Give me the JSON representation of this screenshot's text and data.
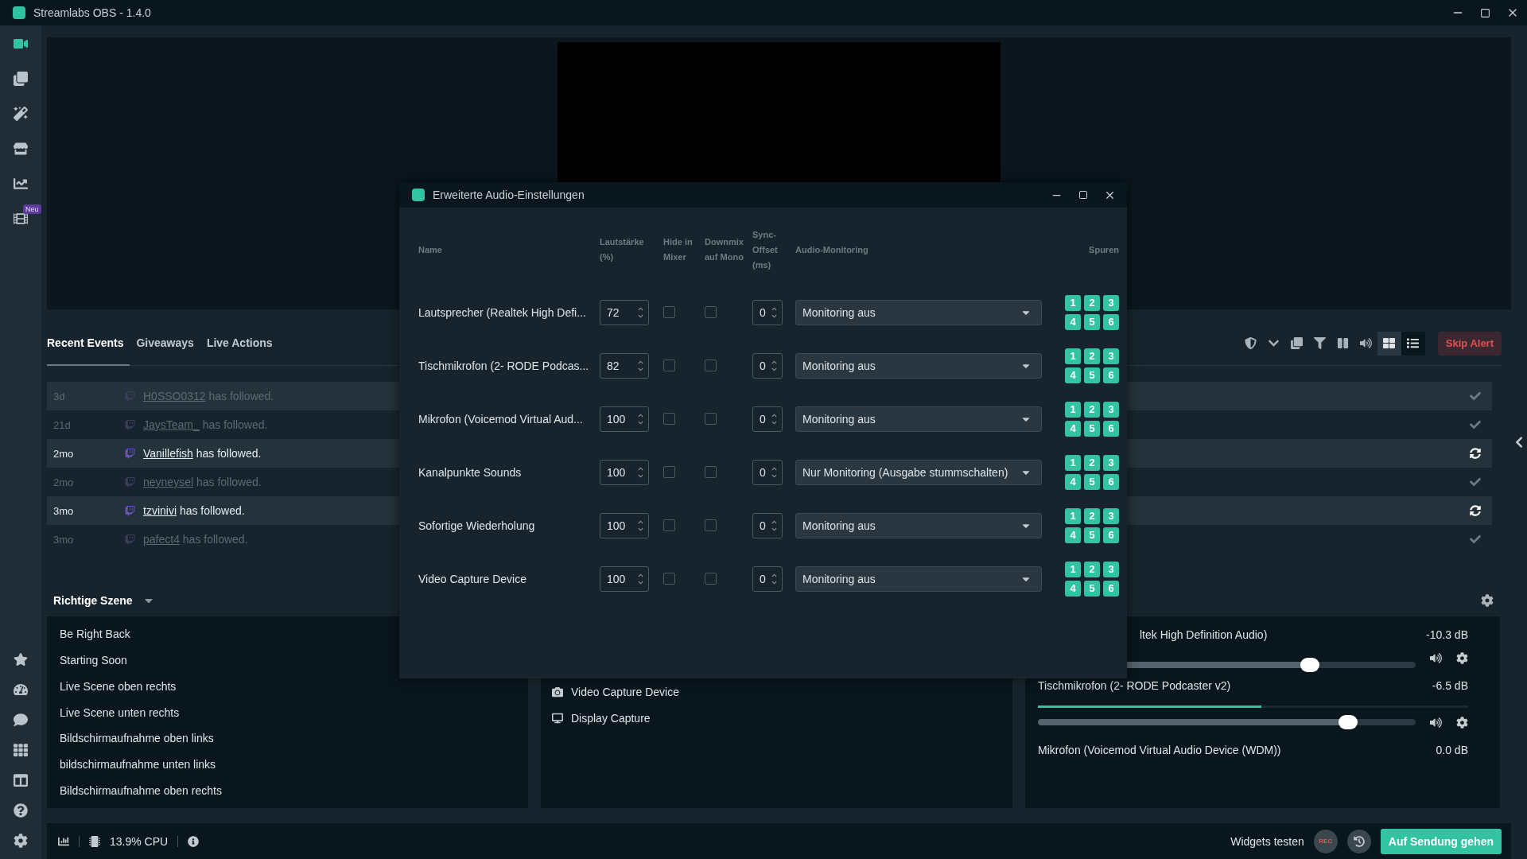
{
  "window": {
    "title": "Streamlabs OBS - 1.4.0"
  },
  "nav": {
    "top": [
      {
        "kind": "studio",
        "selected": true
      },
      {
        "kind": "themes",
        "selected": false
      },
      {
        "kind": "editor",
        "selected": false
      },
      {
        "kind": "store",
        "selected": false
      },
      {
        "kind": "stats",
        "selected": false
      },
      {
        "kind": "highlighter",
        "selected": false,
        "badge": "Neu"
      }
    ],
    "bottom": [
      {
        "kind": "prime"
      },
      {
        "kind": "dashboard"
      },
      {
        "kind": "chat"
      },
      {
        "kind": "layout"
      },
      {
        "kind": "columns"
      },
      {
        "kind": "help"
      },
      {
        "kind": "settings"
      }
    ]
  },
  "events": {
    "tabs": [
      {
        "label": "Recent Events",
        "selected": true
      },
      {
        "label": "Giveaways",
        "selected": false
      },
      {
        "label": "Live Actions",
        "selected": false
      }
    ],
    "views": [
      {
        "kind": "grid",
        "selected": false
      },
      {
        "kind": "list",
        "selected": true
      }
    ],
    "skip_alert": "Skip Alert",
    "rows": [
      {
        "time": "3d",
        "user": "H0SSO0312",
        "text": "has followed.",
        "read": true
      },
      {
        "time": "21d",
        "user": "JaysTeam_",
        "text": "has followed.",
        "read": true
      },
      {
        "time": "2mo",
        "user": "Vanillefish",
        "text": "has followed.",
        "read": false
      },
      {
        "time": "2mo",
        "user": "neyneysel",
        "text": "has followed.",
        "read": true
      },
      {
        "time": "3mo",
        "user": "tzvinivi",
        "text": "has followed.",
        "read": false
      },
      {
        "time": "3mo",
        "user": "pafect4",
        "text": "has followed.",
        "read": true
      }
    ]
  },
  "scenes": {
    "collection": "Richtige Szene",
    "items": [
      "Be Right Back",
      "Starting Soon",
      "Live Scene oben rechts",
      "Live Scene unten rechts",
      "Bildschirmaufnahme oben links",
      "bildschirmaufnahme unten links",
      "Bildschirmaufnahme oben rechts"
    ]
  },
  "sources": {
    "items": [
      {
        "kind": "camera",
        "name": "Video Capture Device"
      },
      {
        "kind": "display",
        "name": "Display Capture"
      }
    ]
  },
  "mixer": {
    "items": [
      {
        "name": "ltek High Definition Audio)",
        "covered": true,
        "reading": "-10.3 dB",
        "volume": {
          "level": 0.72
        }
      },
      {
        "name": "Tischmikrofon (2- RODE Podcaster v2)",
        "covered": false,
        "reading": "-6.5 dB",
        "meter": {
          "level": 0.52
        },
        "volume": {
          "level": 0.82
        }
      },
      {
        "name": "Mikrofon (Voicemod Virtual Audio Device (WDM))",
        "covered": false,
        "reading": "0.0 dB"
      }
    ]
  },
  "footer": {
    "cpu": "13.9% CPU",
    "test_widgets": "Widgets testen",
    "rec": "REC",
    "go_live": "Auf Sendung gehen"
  },
  "dialog": {
    "title": "Erweiterte Audio-Einstellungen",
    "columns": [
      "Name",
      "Lautstärke (%)",
      "Hide in Mixer",
      "Downmix auf Mono",
      "Sync-Offset (ms)",
      "Audio-Monitoring",
      "Spuren"
    ],
    "rows": [
      {
        "name": "Lautsprecher (Realtek High Defi...",
        "volume": "72",
        "hide": false,
        "downmix": false,
        "sync": "0",
        "monitoring": "Monitoring aus",
        "tracks": [
          {
            "label": "1",
            "on": true
          },
          {
            "label": "2",
            "on": true
          },
          {
            "label": "3",
            "on": true
          },
          {
            "label": "4",
            "on": true
          },
          {
            "label": "5",
            "on": true
          },
          {
            "label": "6",
            "on": true
          }
        ]
      },
      {
        "name": "Tischmikrofon (2- RODE Podcas...",
        "volume": "82",
        "hide": false,
        "downmix": false,
        "sync": "0",
        "monitoring": "Monitoring aus",
        "tracks": [
          {
            "label": "1",
            "on": true
          },
          {
            "label": "2",
            "on": true
          },
          {
            "label": "3",
            "on": true
          },
          {
            "label": "4",
            "on": true
          },
          {
            "label": "5",
            "on": true
          },
          {
            "label": "6",
            "on": true
          }
        ]
      },
      {
        "name": "Mikrofon (Voicemod Virtual Aud...",
        "volume": "100",
        "hide": false,
        "downmix": false,
        "sync": "0",
        "monitoring": "Monitoring aus",
        "tracks": [
          {
            "label": "1",
            "on": true
          },
          {
            "label": "2",
            "on": true
          },
          {
            "label": "3",
            "on": true
          },
          {
            "label": "4",
            "on": true
          },
          {
            "label": "5",
            "on": true
          },
          {
            "label": "6",
            "on": true
          }
        ]
      },
      {
        "name": "Kanalpunkte Sounds",
        "volume": "100",
        "hide": false,
        "downmix": false,
        "sync": "0",
        "monitoring": "Nur Monitoring (Ausgabe stummschalten)",
        "tracks": [
          {
            "label": "1",
            "on": true
          },
          {
            "label": "2",
            "on": true
          },
          {
            "label": "3",
            "on": true
          },
          {
            "label": "4",
            "on": true
          },
          {
            "label": "5",
            "on": true
          },
          {
            "label": "6",
            "on": true
          }
        ]
      },
      {
        "name": "Sofortige Wiederholung",
        "volume": "100",
        "hide": false,
        "downmix": false,
        "sync": "0",
        "monitoring": "Monitoring aus",
        "tracks": [
          {
            "label": "1",
            "on": true
          },
          {
            "label": "2",
            "on": true
          },
          {
            "label": "3",
            "on": true
          },
          {
            "label": "4",
            "on": true
          },
          {
            "label": "5",
            "on": true
          },
          {
            "label": "6",
            "on": true
          }
        ]
      },
      {
        "name": "Video Capture Device",
        "volume": "100",
        "hide": false,
        "downmix": false,
        "sync": "0",
        "monitoring": "Monitoring aus",
        "tracks": [
          {
            "label": "1",
            "on": true
          },
          {
            "label": "2",
            "on": true
          },
          {
            "label": "3",
            "on": true
          },
          {
            "label": "4",
            "on": true
          },
          {
            "label": "5",
            "on": true
          },
          {
            "label": "6",
            "on": true
          }
        ]
      }
    ]
  }
}
